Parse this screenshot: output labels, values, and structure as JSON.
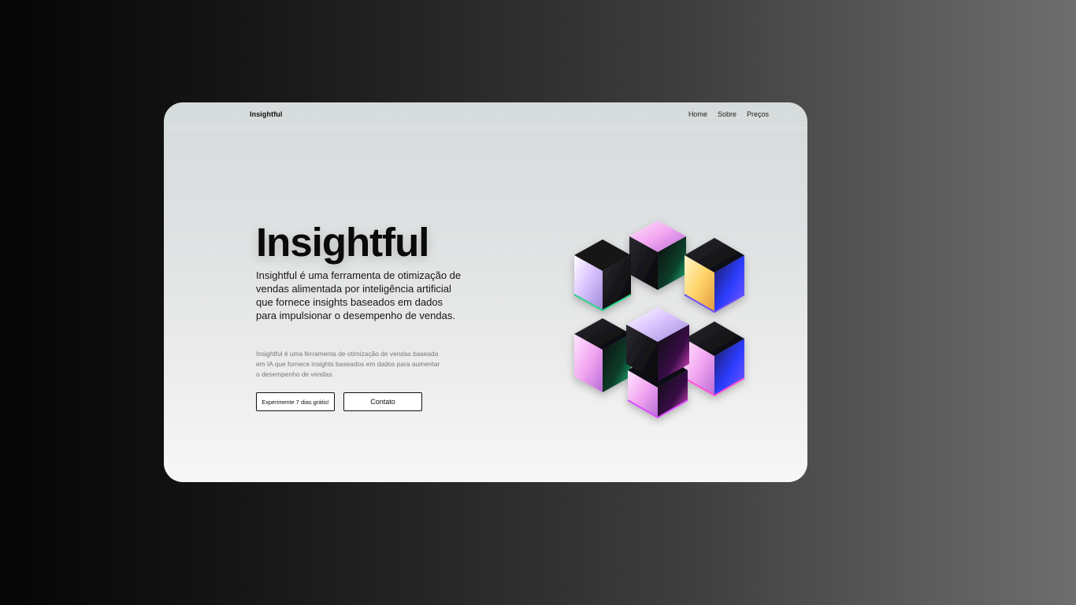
{
  "header": {
    "brand": "Insightful",
    "nav": [
      {
        "label": "Home"
      },
      {
        "label": "Sobre"
      },
      {
        "label": "Preços"
      }
    ]
  },
  "hero": {
    "title": "Insightful",
    "lead": "Insightful é uma ferramenta de otimização de vendas alimentada por inteligência artificial que fornece insights baseados em dados para impulsionar o desempenho de vendas.",
    "description": "Insightful é uma ferramenta de otimização de vendas baseada em IA que fornece insights baseados em dados para aumentar o desempenho de vendas.",
    "primary_button": "Experimente 7 dias grátis!",
    "secondary_button": "Contato"
  },
  "illustration": {
    "icon": "iridescent-cube-cluster",
    "colors": [
      "#0b0b0e",
      "#e3b8ff",
      "#ffe08a",
      "#2a3cff",
      "#1ea86a",
      "#ff4fd8"
    ]
  }
}
